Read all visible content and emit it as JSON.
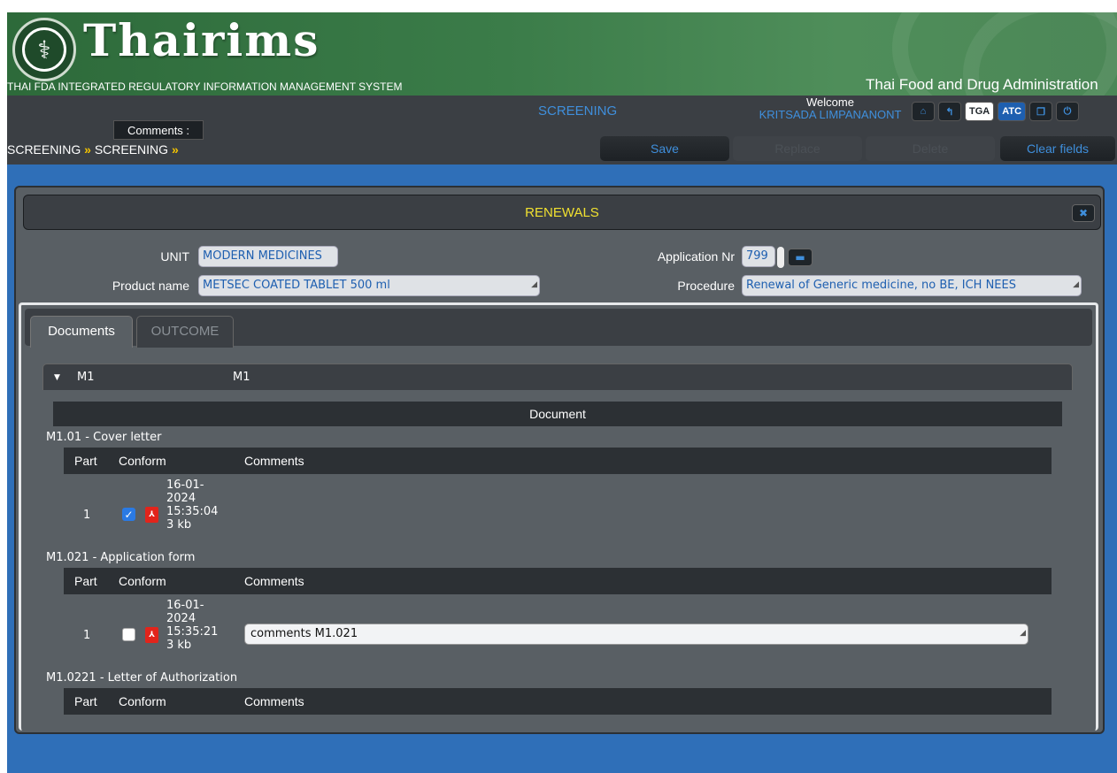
{
  "header": {
    "brand": "Thairims",
    "tagline": "THAI FDA INTEGRATED REGULATORY INFORMATION MANAGEMENT SYSTEM",
    "agency": "Thai Food and Drug Administration",
    "logo_icon": "ministry-seal"
  },
  "topbar": {
    "module": "SCREENING",
    "welcome": "Welcome",
    "user": "KRITSADA LIMPANANONT",
    "icons": {
      "home": "⌂",
      "back": "↰",
      "tga": "TGA",
      "atc": "ATC",
      "window": "❐",
      "power": "⏻"
    }
  },
  "tooltip": {
    "comments": "Comments :"
  },
  "breadcrumb": {
    "first": "SCREENING",
    "second": "SCREENING",
    "sep": "»"
  },
  "actions": {
    "save": "Save",
    "replace": "Replace",
    "delete": "Delete",
    "clear": "Clear fields"
  },
  "panel": {
    "title": "RENEWALS",
    "close_icon": "✖",
    "unit_label": "UNIT",
    "unit_value": "MODERN MEDICINES",
    "product_label": "Product name",
    "product_value": "METSEC COATED TABLET 500 ml",
    "appnr_label": "Application Nr",
    "appnr_value": "799",
    "procedure_label": "Procedure",
    "procedure_value": "Renewal of Generic medicine, no BE, ICH NEES"
  },
  "tabs": {
    "documents": "Documents",
    "outcome": "OUTCOME"
  },
  "section": {
    "key": "M1",
    "value": "M1"
  },
  "documents": {
    "header": "Document",
    "columns": {
      "part": "Part",
      "conform": "Conform",
      "comments": "Comments"
    },
    "groups": [
      {
        "title": "M1.01 - Cover letter",
        "part": "1",
        "conform": true,
        "date": "16-01-\n2024\n15:35:04\n3 kb",
        "comment": ""
      },
      {
        "title": "M1.021 - Application form",
        "part": "1",
        "conform": false,
        "date": "16-01-\n2024\n15:35:21\n3 kb",
        "comment": "comments M1.021"
      },
      {
        "title": "M1.0221 - Letter of Authorization"
      }
    ]
  }
}
